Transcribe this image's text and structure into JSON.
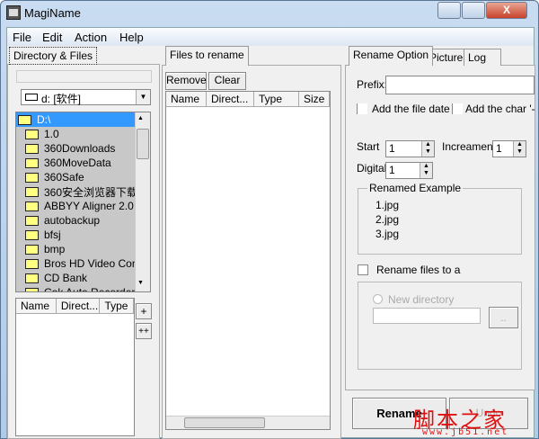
{
  "window": {
    "title": "MagiName",
    "close_glyph": "X"
  },
  "menu": [
    "File",
    "Edit",
    "Action",
    "Help"
  ],
  "left": {
    "tab": "Directory & Files",
    "drive": "d: [软件]",
    "tree": [
      "D:\\",
      "1.0",
      "360Downloads",
      "360MoveData",
      "360Safe",
      "360安全浏览器下载",
      "ABBYY Aligner 2.0",
      "autobackup",
      "bfsj",
      "bmp",
      "Bros HD Video Conve",
      "CD Bank",
      "Cok Auto Recorder"
    ],
    "columns": [
      "Name",
      "Direct...",
      "Type"
    ],
    "add": "+",
    "add_all": "++"
  },
  "middle": {
    "tab": "Files to rename",
    "remove": "Remove",
    "clear": "Clear",
    "columns": [
      "Name",
      "Direct...",
      "Type",
      "Size"
    ]
  },
  "right": {
    "tabs": [
      "Rename Option",
      "Picture",
      "Log"
    ],
    "prefix_label": "Prefix:",
    "prefix_value": "",
    "add_date": "Add the file date",
    "add_char": "Add the char '-",
    "start_label": "Start",
    "start": "1",
    "increment_label": "Increament",
    "increment": "1",
    "digital_label": "Digital",
    "digital": "1",
    "example_title": "Renamed Example",
    "examples": [
      "1.jpg",
      "2.jpg",
      "3.jpg"
    ],
    "rename_to": "Rename files to a",
    "new_dir": "New directory",
    "browse": "..",
    "rename": "Rename",
    "undo": "Undo"
  },
  "watermark": {
    "cn": "脚本之家",
    "url": "www.jb51.net"
  }
}
